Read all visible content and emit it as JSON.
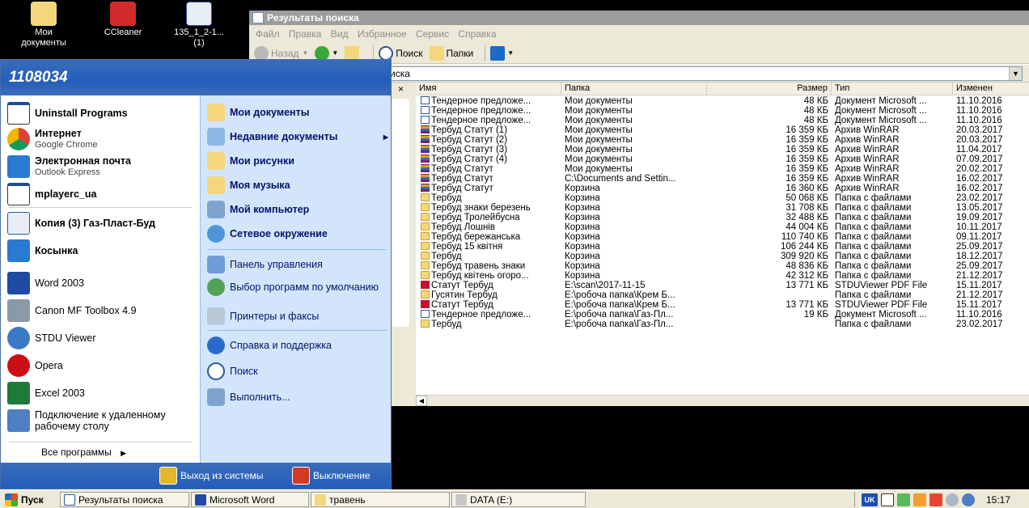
{
  "desktop": {
    "icons": [
      {
        "label": "Мои\nдокументы",
        "icon": "my-documents-icon"
      },
      {
        "label": "CCleaner",
        "icon": "ccleaner-icon"
      },
      {
        "label": "135_1_2-1...\n(1)",
        "icon": "word-doc-icon"
      }
    ]
  },
  "explorer": {
    "title": "Результаты поиска",
    "menu": [
      "Файл",
      "Правка",
      "Вид",
      "Избранное",
      "Сервис",
      "Справка"
    ],
    "toolbar": {
      "back": "Назад",
      "search": "Поиск",
      "folders": "Папки"
    },
    "address_fragment": "иска",
    "columns": [
      "Имя",
      "Папка",
      "Размер",
      "Тип",
      "Изменен"
    ],
    "rows": [
      {
        "icon": "doc",
        "name": "Тендерное предложе...",
        "folder": "Мои документы",
        "size": "48 КБ",
        "type": "Документ Microsoft ...",
        "date": "11.10.2016"
      },
      {
        "icon": "doc",
        "name": "Тендерное предложе...",
        "folder": "Мои документы",
        "size": "48 КБ",
        "type": "Документ Microsoft ...",
        "date": "11.10.2016"
      },
      {
        "icon": "doc",
        "name": "Тендерное предложе...",
        "folder": "Мои документы",
        "size": "48 КБ",
        "type": "Документ Microsoft ...",
        "date": "11.10.2016"
      },
      {
        "icon": "rar",
        "name": "Тербуд Статут (1)",
        "folder": "Мои документы",
        "size": "16 359 КБ",
        "type": "Архив WinRAR",
        "date": "20.03.2017"
      },
      {
        "icon": "rar",
        "name": "Тербуд Статут (2)",
        "folder": "Мои документы",
        "size": "16 359 КБ",
        "type": "Архив WinRAR",
        "date": "20.03.2017"
      },
      {
        "icon": "rar",
        "name": "Тербуд Статут (3)",
        "folder": "Мои документы",
        "size": "16 359 КБ",
        "type": "Архив WinRAR",
        "date": "11.04.2017"
      },
      {
        "icon": "rar",
        "name": "Тербуд Статут (4)",
        "folder": "Мои документы",
        "size": "16 359 КБ",
        "type": "Архив WinRAR",
        "date": "07.09.2017"
      },
      {
        "icon": "rar",
        "name": "Тербуд Статут",
        "folder": "Мои документы",
        "size": "16 359 КБ",
        "type": "Архив WinRAR",
        "date": "20.02.2017"
      },
      {
        "icon": "rar",
        "name": "Тербуд Статут",
        "folder": "C:\\Documents and Settin...",
        "size": "16 359 КБ",
        "type": "Архив WinRAR",
        "date": "16.02.2017"
      },
      {
        "icon": "rar",
        "name": "Тербуд Статут",
        "folder": "Корзина",
        "size": "16 360 КБ",
        "type": "Архив WinRAR",
        "date": "16.02.2017"
      },
      {
        "icon": "folder",
        "name": "Тербуд",
        "folder": "Корзина",
        "size": "50 068 КБ",
        "type": "Папка с файлами",
        "date": "23.02.2017"
      },
      {
        "icon": "folder",
        "name": "Тербуд знаки березень",
        "folder": "Корзина",
        "size": "31 708 КБ",
        "type": "Папка с файлами",
        "date": "13.05.2017"
      },
      {
        "icon": "folder",
        "name": "Тербуд Тролейбусна",
        "folder": "Корзина",
        "size": "32 488 КБ",
        "type": "Папка с файлами",
        "date": "19.09.2017"
      },
      {
        "icon": "folder",
        "name": "Тербуд Лошнів",
        "folder": "Корзина",
        "size": "44 004 КБ",
        "type": "Папка с файлами",
        "date": "10.11.2017"
      },
      {
        "icon": "folder",
        "name": "Тербуд бережанська",
        "folder": "Корзина",
        "size": "110 740 КБ",
        "type": "Папка с файлами",
        "date": "09.11.2017"
      },
      {
        "icon": "folder",
        "name": "Тербуд 15 квітня",
        "folder": "Корзина",
        "size": "106 244 КБ",
        "type": "Папка с файлами",
        "date": "25.09.2017"
      },
      {
        "icon": "folder",
        "name": "Тербуд",
        "folder": "Корзина",
        "size": "309 920 КБ",
        "type": "Папка с файлами",
        "date": "18.12.2017"
      },
      {
        "icon": "folder",
        "name": "Тербуд травень знаки",
        "folder": "Корзина",
        "size": "48 836 КБ",
        "type": "Папка с файлами",
        "date": "25.09.2017"
      },
      {
        "icon": "folder",
        "name": "Тербуд квітень огоро...",
        "folder": "Корзина",
        "size": "42 312 КБ",
        "type": "Папка с файлами",
        "date": "21.12.2017"
      },
      {
        "icon": "pdf",
        "name": "Статут Тербуд",
        "folder": "E:\\scan\\2017-11-15",
        "size": "13 771 КБ",
        "type": "STDUViewer PDF File",
        "date": "15.11.2017"
      },
      {
        "icon": "folder",
        "name": "Гусятин Тербуд",
        "folder": "E:\\робоча папка\\Крем Б...",
        "size": "",
        "type": "Папка с файлами",
        "date": "21.12.2017"
      },
      {
        "icon": "pdf",
        "name": "Статут Тербуд",
        "folder": "E:\\робоча папка\\Крем Б...",
        "size": "13 771 КБ",
        "type": "STDUViewer PDF File",
        "date": "15.11.2017"
      },
      {
        "icon": "doc",
        "name": "Тендерное предложе...",
        "folder": "E:\\робоча папка\\Газ-Пл...",
        "size": "19 КБ",
        "type": "Документ Microsoft ...",
        "date": "11.10.2016"
      },
      {
        "icon": "folder",
        "name": "Тербуд",
        "folder": "E:\\робоча папка\\Газ-Пл...",
        "size": "",
        "type": "Папка с файлами",
        "date": "23.02.2017"
      }
    ]
  },
  "start_menu": {
    "user": "1108034",
    "pinned": [
      {
        "title": "Uninstall Programs",
        "sub": "",
        "icon": "uninstall-icon"
      },
      {
        "title": "Интернет",
        "sub": "Google Chrome",
        "icon": "chrome-icon"
      },
      {
        "title": "Электронная почта",
        "sub": "Outlook Express",
        "icon": "outlook-express-icon"
      },
      {
        "title": "mplayerc_ua",
        "sub": "",
        "icon": "mplayer-icon"
      }
    ],
    "recent": [
      {
        "title": "Копия (3) Газ-Пласт-Буд",
        "bold": true,
        "icon": "word-doc-icon"
      },
      {
        "title": "Косынка",
        "bold": true,
        "icon": "solitaire-icon"
      },
      {
        "title": "Word 2003",
        "bold": false,
        "icon": "word-icon"
      },
      {
        "title": "Canon MF Toolbox 4.9",
        "bold": false,
        "icon": "canon-icon"
      },
      {
        "title": "STDU Viewer",
        "bold": false,
        "icon": "stdu-viewer-icon"
      },
      {
        "title": "Opera",
        "bold": false,
        "icon": "opera-icon"
      },
      {
        "title": "Excel 2003",
        "bold": false,
        "icon": "excel-icon"
      },
      {
        "title": "Подключение к удаленному рабочему столу",
        "bold": false,
        "icon": "remote-desktop-icon"
      }
    ],
    "all_programs": "Все программы",
    "right": [
      {
        "title": "Мои документы",
        "bold": true,
        "icon": "my-documents-icon"
      },
      {
        "title": "Недавние документы",
        "bold": true,
        "icon": "recent-documents-icon"
      },
      {
        "title": "Мои рисунки",
        "bold": true,
        "icon": "my-pictures-icon"
      },
      {
        "title": "Моя музыка",
        "bold": true,
        "icon": "my-music-icon"
      },
      {
        "title": "Мой компьютер",
        "bold": true,
        "icon": "my-computer-icon"
      },
      {
        "title": "Сетевое окружение",
        "bold": true,
        "icon": "network-icon"
      },
      {
        "title": "Панель управления",
        "bold": false,
        "icon": "control-panel-icon"
      },
      {
        "title": "Выбор программ по умолчанию",
        "bold": false,
        "icon": "default-programs-icon"
      },
      {
        "title": "Принтеры и факсы",
        "bold": false,
        "icon": "printers-icon"
      },
      {
        "title": "Справка и поддержка",
        "bold": false,
        "icon": "help-icon"
      },
      {
        "title": "Поиск",
        "bold": false,
        "icon": "search-icon"
      },
      {
        "title": "Выполнить...",
        "bold": false,
        "icon": "run-icon"
      }
    ],
    "logoff": "Выход из системы",
    "shutdown": "Выключение"
  },
  "taskbar": {
    "start": "Пуск",
    "tasks": [
      "Результаты поиска",
      "Microsoft Word",
      "травень",
      "DATA (E:)"
    ],
    "lang": "UK",
    "clock": "15:17"
  }
}
